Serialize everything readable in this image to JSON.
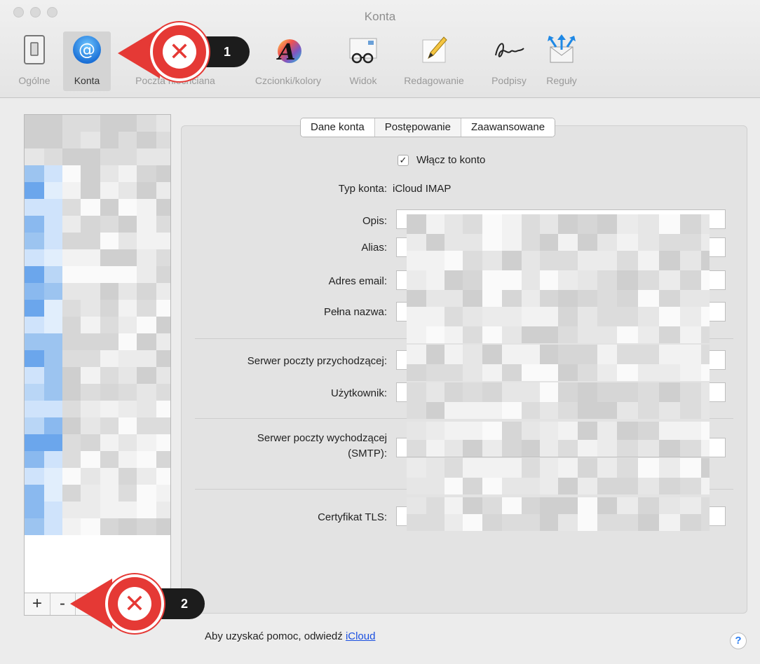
{
  "window": {
    "title": "Konta"
  },
  "toolbar": {
    "items": [
      {
        "label": "Ogólne",
        "icon": "general-switch-icon"
      },
      {
        "label": "Konta",
        "icon": "at-sign-icon"
      },
      {
        "label": "Poczta niechciana",
        "icon": "junk-mail-icon"
      },
      {
        "label": "Czcionki/kolory",
        "icon": "font-color-icon"
      },
      {
        "label": "Widok",
        "icon": "glasses-view-icon"
      },
      {
        "label": "Redagowanie",
        "icon": "pencil-compose-icon"
      },
      {
        "label": "Podpisy",
        "icon": "signature-icon"
      },
      {
        "label": "Reguły",
        "icon": "rules-arrows-icon"
      }
    ]
  },
  "tabs": [
    {
      "label": "Dane konta",
      "selected": false
    },
    {
      "label": "Postępowanie",
      "selected": true
    },
    {
      "label": "Zaawansowane",
      "selected": false
    }
  ],
  "form": {
    "enable_label": "Włącz to konto",
    "enable_checked": true,
    "account_type_label": "Typ konta:",
    "account_type_value": "iCloud IMAP",
    "description_label": "Opis:",
    "alias_label": "Alias:",
    "email_label": "Adres email:",
    "fullname_label": "Pełna nazwa:",
    "incoming_server_label": "Serwer poczty przychodzącej:",
    "user_label": "Użytkownik:",
    "outgoing_server_label_1": "Serwer poczty wychodzącej",
    "outgoing_server_label_2": "(SMTP):",
    "tls_label": "Certyfikat TLS:"
  },
  "sidebar": {
    "add_label": "+",
    "remove_label": "-"
  },
  "footer": {
    "help_prefix": "Aby uzyskać pomoc, odwiedź ",
    "help_link": "iCloud",
    "help_button": "?"
  },
  "callouts": [
    {
      "number": "1"
    },
    {
      "number": "2"
    }
  ],
  "colors": {
    "accent": "#2a7cf0",
    "callout_red": "#e53935",
    "link_blue": "#1a4fe0"
  }
}
